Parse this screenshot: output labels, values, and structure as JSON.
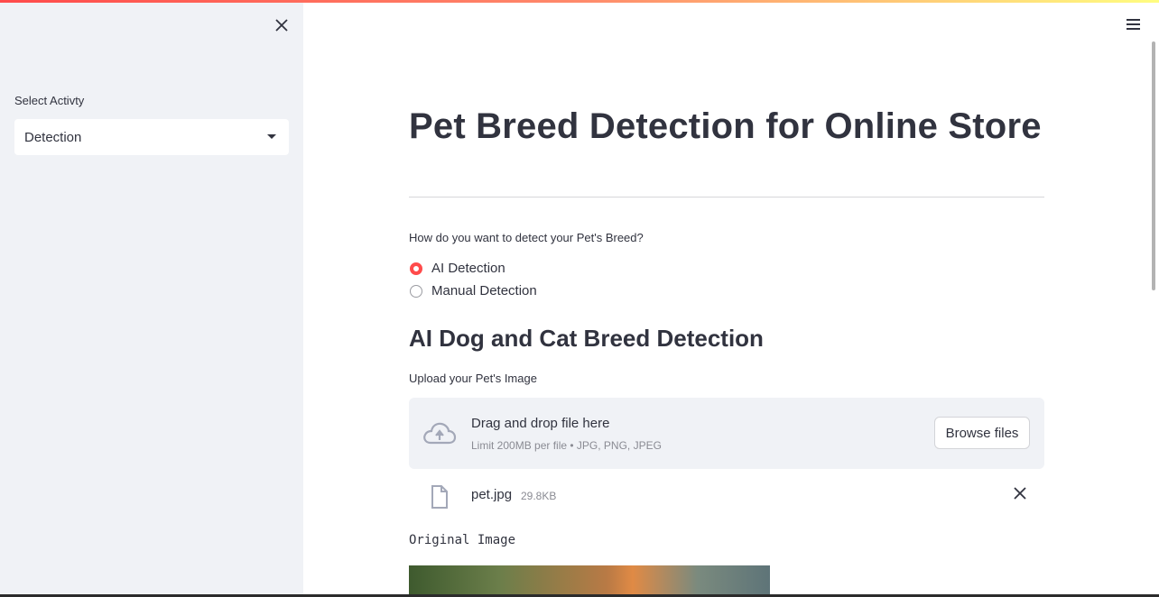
{
  "sidebar": {
    "close_icon": "close-icon",
    "select_label": "Select Activty",
    "select_value": "Detection"
  },
  "header": {
    "menu_icon": "hamburger-menu-icon"
  },
  "main": {
    "title": "Pet Breed Detection for Online Store",
    "question": "How do you want to detect your Pet's Breed?",
    "radio_options": [
      {
        "label": "AI Detection",
        "selected": true
      },
      {
        "label": "Manual Detection",
        "selected": false
      }
    ],
    "section_title": "AI Dog and Cat Breed Detection",
    "upload_label": "Upload your Pet's Image",
    "dropzone": {
      "icon": "cloud-upload-icon",
      "main_text": "Drag and drop file here",
      "sub_text": "Limit 200MB per file • JPG, PNG, JPEG",
      "button_label": "Browse files"
    },
    "uploaded_file": {
      "icon": "file-icon",
      "name": "pet.jpg",
      "size": "29.8KB"
    },
    "image_caption": "Original Image"
  },
  "colors": {
    "accent": "#ff4b4b",
    "sidebar_bg": "#f0f2f6",
    "text": "#31333f"
  }
}
